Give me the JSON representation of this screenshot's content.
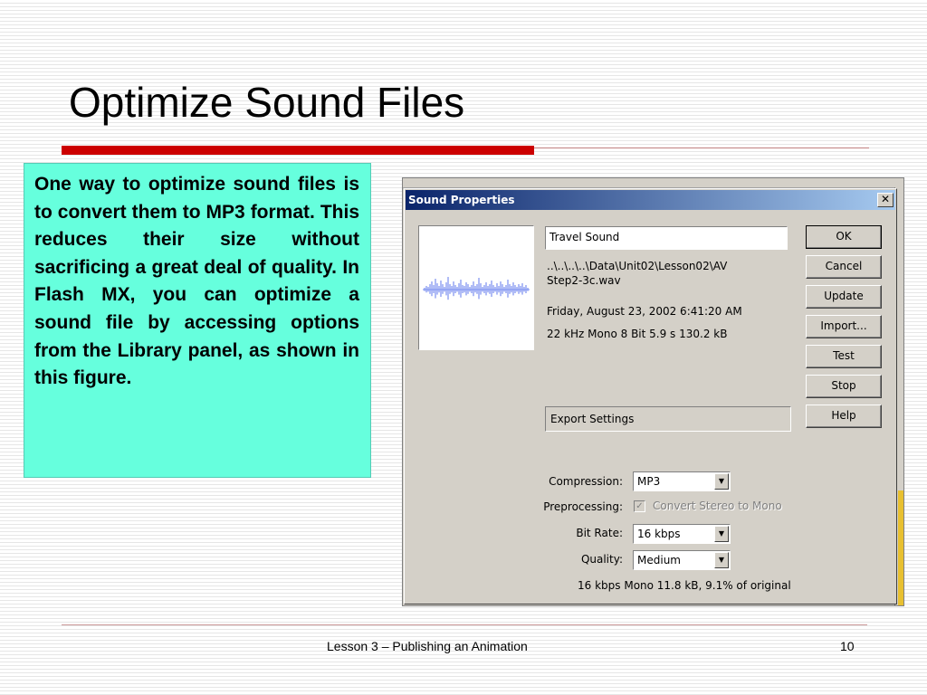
{
  "slide": {
    "title": "Optimize Sound Files",
    "body": "One way to optimize sound files is to convert them to MP3 format. This reduces their size without sacrificing a great deal of quality. In Flash MX, you can optimize a sound file by accessing options from the Library panel, as shown in this figure.",
    "footer": "Lesson 3 – Publishing an Animation",
    "page_number": "10"
  },
  "dialog": {
    "title": "Sound Properties",
    "close_glyph": "✕",
    "sound_name": "Travel Sound",
    "path_line1": "..\\..\\..\\..\\Data\\Unit02\\Lesson02\\AV",
    "path_line2": "Step2-3c.wav",
    "date": "Friday, August 23, 2002  6:41:20 AM",
    "format_info": "22 kHz Mono 8 Bit 5.9 s 130.2 kB",
    "export_settings": "Export Settings",
    "buttons": {
      "ok": "OK",
      "cancel": "Cancel",
      "update": "Update",
      "import": "Import...",
      "test": "Test",
      "stop": "Stop",
      "help": "Help"
    },
    "compression_label": "Compression:",
    "compression_value": "MP3",
    "preprocessing_label": "Preprocessing:",
    "preprocessing_option": "Convert Stereo to Mono",
    "preprocessing_checked": true,
    "preprocessing_enabled": false,
    "bitrate_label": "Bit Rate:",
    "bitrate_value": "16 kbps",
    "quality_label": "Quality:",
    "quality_value": "Medium",
    "summary": "16 kbps Mono 11.8 kB, 9.1% of original",
    "dropdown_glyph": "▼",
    "check_glyph": "✓"
  },
  "colors": {
    "title_rule": "#cc0000",
    "textbox_bg": "#66ffdd",
    "dialog_face": "#d4d0c8",
    "titlebar_start": "#0a246a",
    "titlebar_end": "#a6caf0",
    "waveform": "#7a8ff0"
  }
}
